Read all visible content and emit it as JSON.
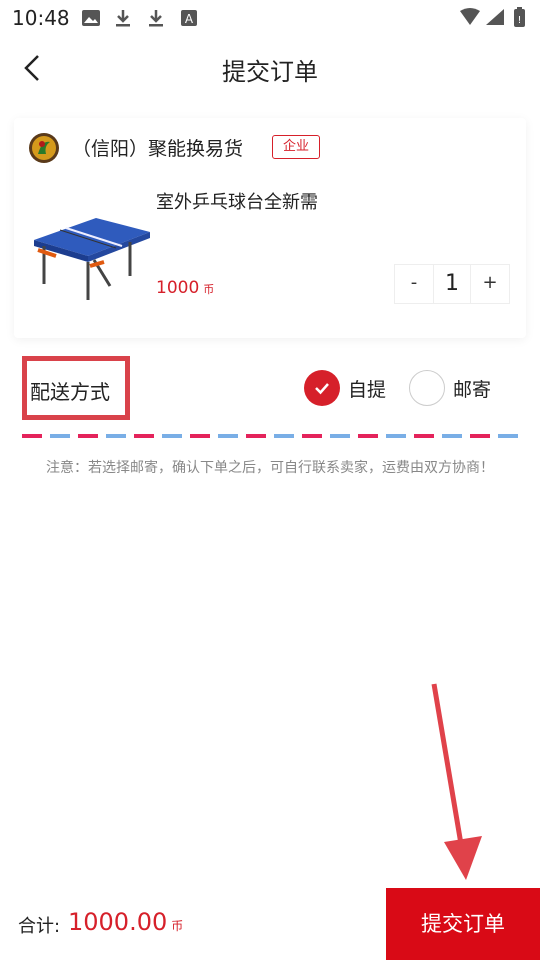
{
  "status_bar": {
    "time": "10:48"
  },
  "header": {
    "title": "提交订单"
  },
  "shop": {
    "name": "（信阳）聚能换易货",
    "tag": "企业"
  },
  "product": {
    "name": "室外乒乓球台全新需",
    "price": "1000",
    "price_unit": "币",
    "quantity": "1",
    "minus": "-",
    "plus": "+"
  },
  "delivery": {
    "label": "配送方式",
    "options": [
      {
        "label": "自提",
        "selected": true
      },
      {
        "label": "邮寄",
        "selected": false
      }
    ]
  },
  "notice": "注意：若选择邮寄，确认下单之后，可自行联系卖家，运费由双方协商！",
  "footer": {
    "total_label": "合计:",
    "total_value": "1000.00",
    "total_unit": "币",
    "submit_label": "提交订单"
  },
  "colors": {
    "accent": "#d6202a",
    "submit_bg": "#d90a16",
    "annotation": "#d9424a"
  }
}
